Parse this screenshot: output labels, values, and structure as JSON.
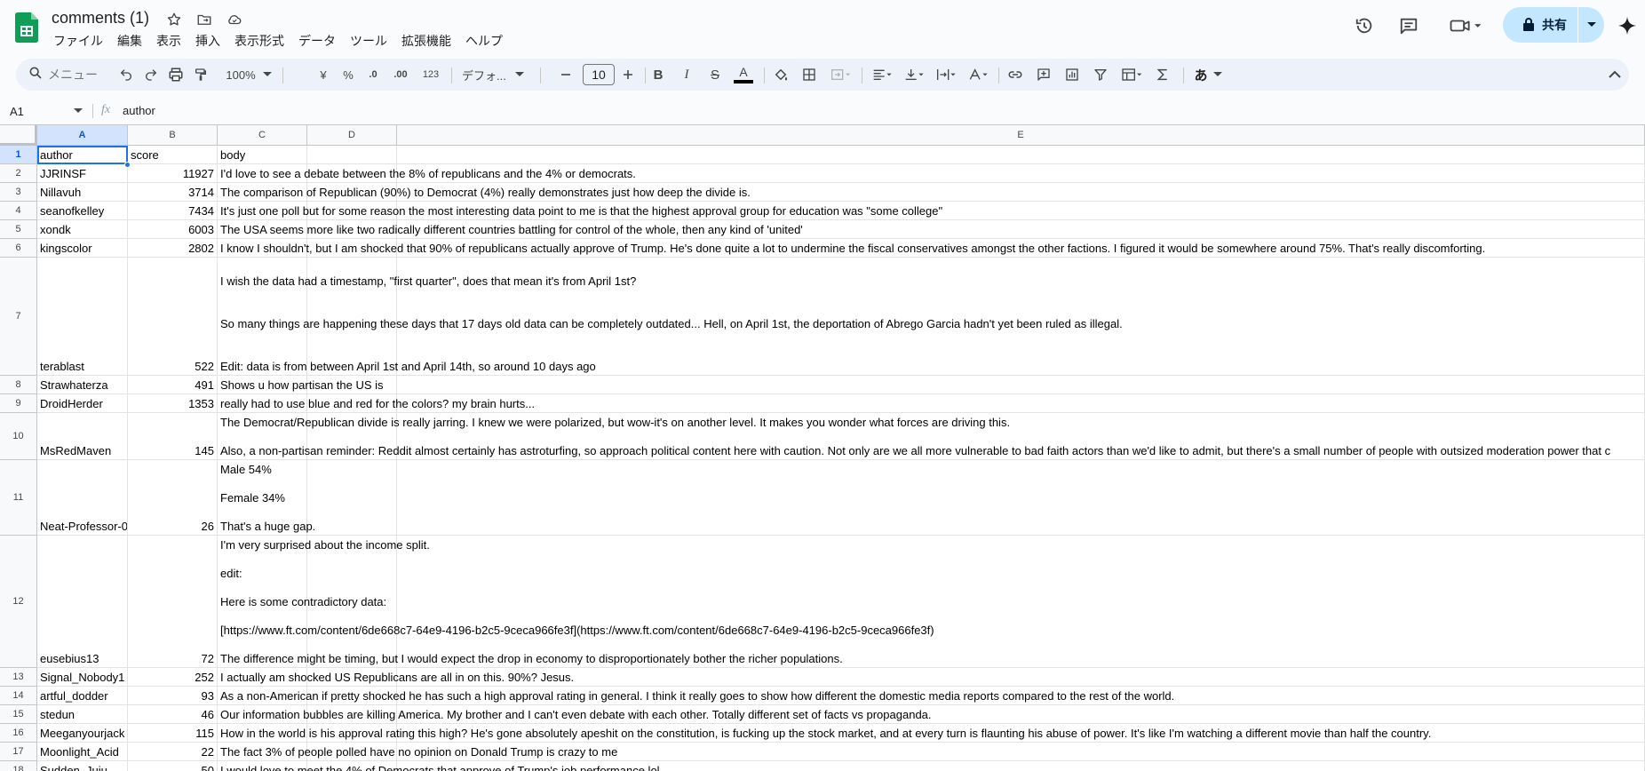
{
  "document": {
    "title": "comments (1)"
  },
  "menu": [
    "ファイル",
    "編集",
    "表示",
    "挿入",
    "表示形式",
    "データ",
    "ツール",
    "拡張機能",
    "ヘルプ"
  ],
  "share": {
    "label": "共有"
  },
  "toolbar": {
    "search_placeholder": "メニュー",
    "zoom": "100%",
    "currency": "¥",
    "percent": "%",
    "decrease_decimal": ".0",
    "increase_decimal": ".00",
    "number_format": "123",
    "font": "デフォ...",
    "font_size": "10",
    "bold": "B",
    "italic": "I",
    "strike": "S",
    "text_color": "A",
    "input_tools": "あ"
  },
  "formula_bar": {
    "cell_ref": "A1",
    "fx": "fx",
    "content": "author"
  },
  "columns": [
    "A",
    "B",
    "C",
    "D",
    "E"
  ],
  "rows": [
    {
      "num": "1",
      "author": "author",
      "score": "score",
      "body": [
        "body"
      ]
    },
    {
      "num": "2",
      "author": "JJRINSF",
      "score": "11927",
      "body": [
        "I'd love to see a debate between the 8% of republicans and the 4% or democrats."
      ]
    },
    {
      "num": "3",
      "author": "Nillavuh",
      "score": "3714",
      "body": [
        "The comparison of Republican (90%) to Democrat (4%) really demonstrates just how deep the divide is."
      ]
    },
    {
      "num": "4",
      "author": "seanofkelley",
      "score": "7434",
      "body": [
        "It's just one poll but for some reason the most interesting data point to me is that the highest approval group for education was \"some college\""
      ]
    },
    {
      "num": "5",
      "author": "xondk",
      "score": "6003",
      "body": [
        "The USA seems more like two radically different countries battling for control of the whole, then any kind of 'united'"
      ]
    },
    {
      "num": "6",
      "author": "kingscolor",
      "score": "2802",
      "body": [
        "I know I shouldn't, but I am shocked that 90% of republicans actually approve of Trump. He's done quite a lot to undermine the fiscal conservatives amongst the other factions. I figured it would be somewhere around 75%. That's really discomforting."
      ]
    },
    {
      "num": "7",
      "author": "terablast",
      "score": "522",
      "body": [
        "I wish the data had a timestamp, \"first quarter\", does that mean it's from April 1st?",
        "",
        "",
        "So many things are happening these days that 17 days old data can be completely outdated... Hell, on April 1st, the deportation of Abrego Garcia hadn't yet been ruled as illegal.",
        "",
        "",
        "Edit: data is from between April 1st and April 14th, so around 10 days ago"
      ]
    },
    {
      "num": "8",
      "author": "Strawhaterza",
      "score": "491",
      "body": [
        "Shows u how partisan the US is"
      ]
    },
    {
      "num": "9",
      "author": "DroidHerder",
      "score": "1353",
      "body": [
        "really had to use blue and red for the colors? my brain hurts..."
      ]
    },
    {
      "num": "10",
      "author": "MsRedMaven",
      "score": "145",
      "body": [
        "The Democrat/Republican divide is really jarring. I knew we were polarized, but wow-it's on another level. It makes you wonder what forces are driving this.",
        "",
        "Also, a non-partisan reminder: Reddit almost certainly has astroturfing, so approach political content here with caution. Not only are we all more vulnerable to bad faith actors than we'd like to admit, but there's a small number of people with outsized moderation power that c"
      ]
    },
    {
      "num": "11",
      "author": "Neat-Professor-0",
      "score": "26",
      "body": [
        "Male 54%",
        "",
        "Female 34%",
        "",
        "That's a huge gap."
      ]
    },
    {
      "num": "12",
      "author": "eusebius13",
      "score": "72",
      "body": [
        "I'm very surprised about the income split.",
        "",
        "edit:",
        "",
        "Here is some contradictory data:",
        "",
        "[https://www.ft.com/content/6de668c7-64e9-4196-b2c5-9ceca966fe3f](https://www.ft.com/content/6de668c7-64e9-4196-b2c5-9ceca966fe3f)",
        "",
        "The difference might be timing, but I would expect the drop in economy to disproportionately bother the richer populations."
      ]
    },
    {
      "num": "13",
      "author": "Signal_Nobody1",
      "score": "252",
      "body": [
        "I actually am shocked US Republicans are all in on this. 90%? Jesus."
      ]
    },
    {
      "num": "14",
      "author": "artful_dodder",
      "score": "93",
      "body": [
        "As a non-American if pretty shocked he has such a high approval rating in general. I think it really goes to show how different the domestic media reports compared to the rest of the world."
      ]
    },
    {
      "num": "15",
      "author": "stedun",
      "score": "46",
      "body": [
        "Our information bubbles are killing America.  My brother and I can't even debate with each other.  Totally different set of facts vs propaganda."
      ]
    },
    {
      "num": "16",
      "author": "Meeganyourjack",
      "score": "115",
      "body": [
        "How in the world is his approval rating this high? He's gone absolutely apeshit on the constitution, is fucking up the stock market, and at every turn is flaunting his abuse of power. It's like I'm watching a different movie than half the country."
      ]
    },
    {
      "num": "17",
      "author": "Moonlight_Acid",
      "score": "22",
      "body": [
        "The fact 3% of people polled have no opinion on Donald Trump is crazy to me"
      ]
    },
    {
      "num": "18",
      "author": "Sudden_Juju",
      "score": "50",
      "body": [
        "I would love to meet the 4% of Democrats that approve of Trump's job performance lol"
      ]
    }
  ]
}
